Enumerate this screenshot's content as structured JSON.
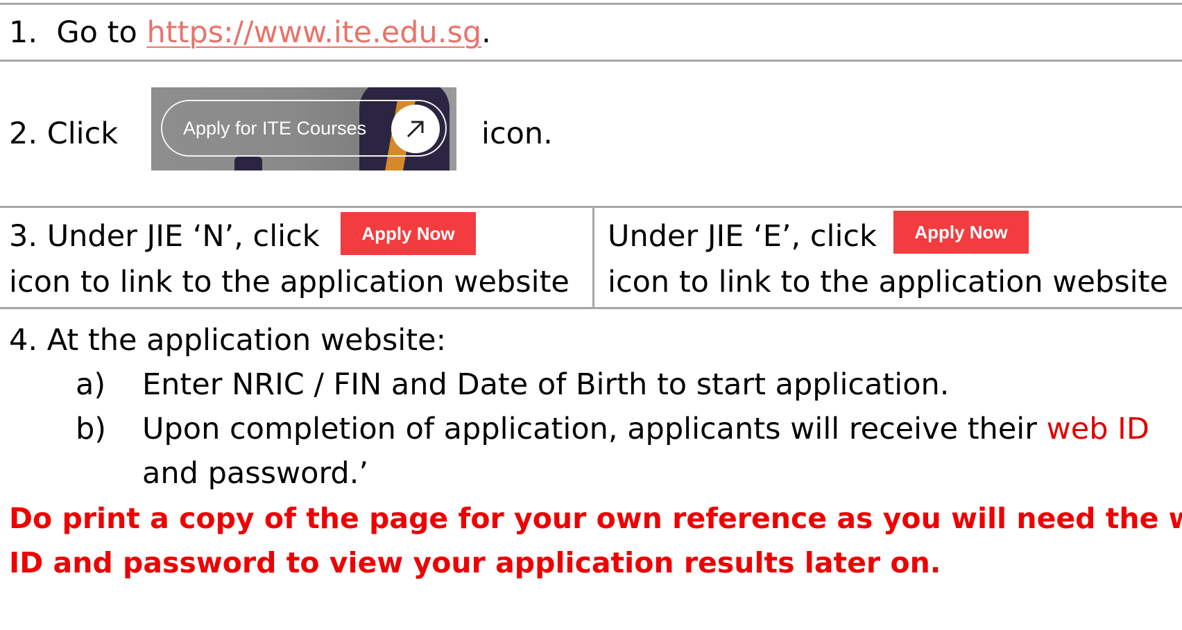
{
  "step1": {
    "prefix": "1.  Go to ",
    "link": "https://www.ite.edu.sg",
    "suffix": "."
  },
  "step2": {
    "prefix": "2. Click",
    "suffix": "icon.",
    "banner_label": "Apply for ITE Courses",
    "banner_icon": "arrow-up-right-icon"
  },
  "step3": {
    "left_line1": "3. Under JIE ‘N’, click",
    "left_line2": "icon to link to the application website",
    "right_line1": "Under JIE ‘E’, click",
    "right_line2": "icon to link to the application website",
    "button_label": "Apply Now"
  },
  "step4": {
    "heading": "4. At the application website:",
    "items": [
      {
        "marker": "a)",
        "text": "Enter NRIC / FIN and Date of Birth to start application."
      },
      {
        "marker": "b)",
        "text_before": "Upon completion of application, applicants will receive their ",
        "highlight": "web ID",
        "text_after": "and password.’"
      }
    ]
  },
  "warning": {
    "line1": "Do print a copy of the page for your own reference as you will need the web",
    "line2": "ID and password to view your application results later on."
  },
  "colors": {
    "link": "#e8736a",
    "accent_red": "#e00000",
    "button_red": "#f23c40",
    "border_gray": "#a6a6a6"
  }
}
